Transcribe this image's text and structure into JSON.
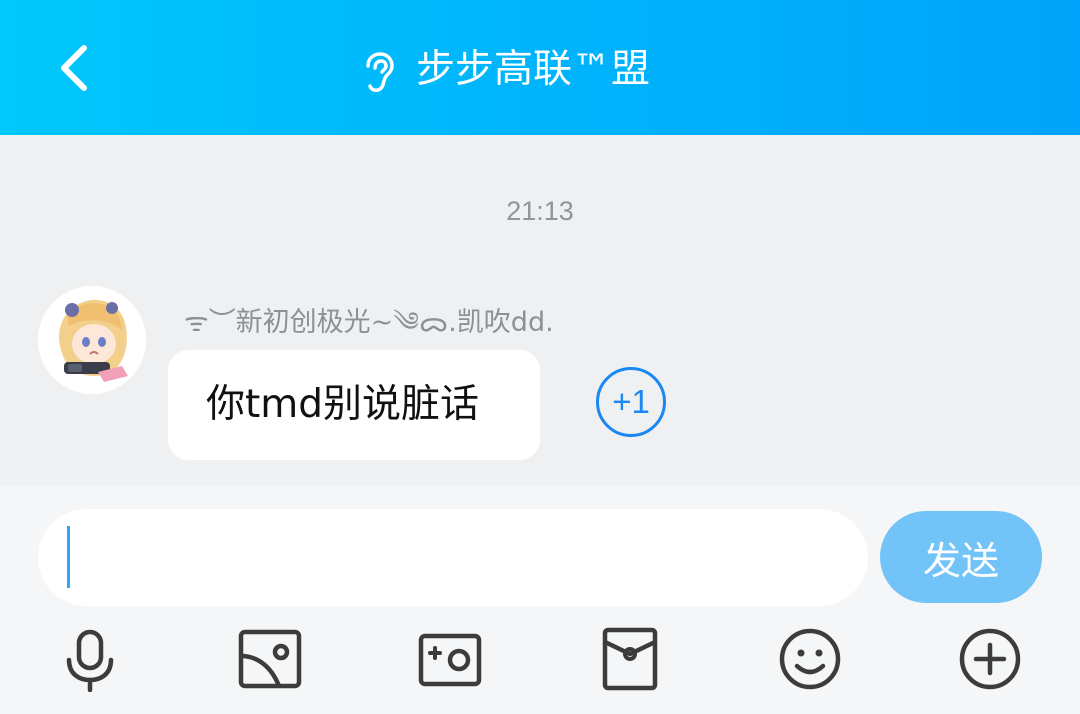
{
  "header": {
    "back_icon": "chevron-left-icon",
    "ear_icon": "ear-icon",
    "title": "步步高联™盟",
    "background_colors": [
      "#00c8fb",
      "#00a4fa"
    ]
  },
  "chat": {
    "timestamp": "21:13",
    "messages": [
      {
        "sender": "ᯤ︶新初创极光~༄ᯅ.凯吹dd.",
        "text": "你tmd别说脏话",
        "plus_one_label": "+1"
      }
    ]
  },
  "input": {
    "value": "",
    "placeholder": "",
    "send_label": "发送",
    "send_color": "#72c4f8",
    "caret_color": "#2ea7f3"
  },
  "toolbar": {
    "icons": [
      "microphone-icon",
      "picture-icon",
      "camera-icon",
      "red-packet-icon",
      "emoji-icon",
      "plus-icon"
    ]
  }
}
